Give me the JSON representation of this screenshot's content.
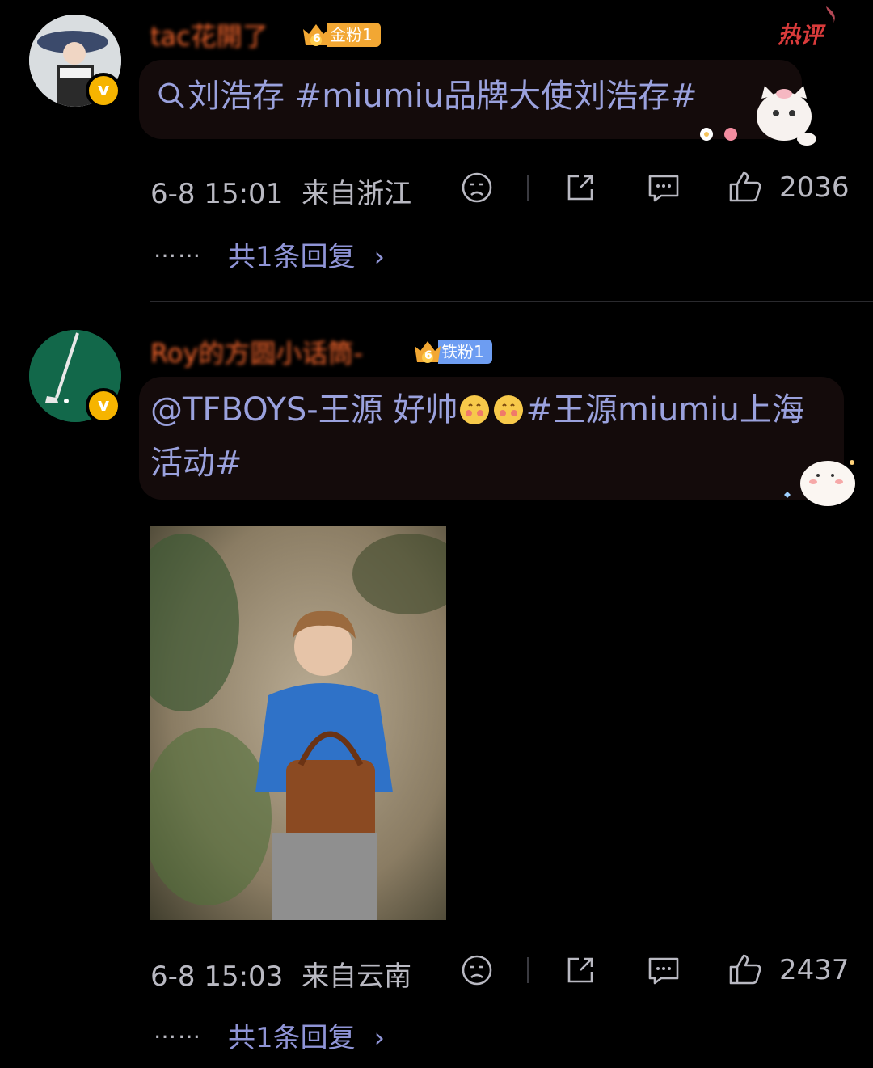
{
  "hot_badge": "热评",
  "comments": [
    {
      "username": "tac花開了",
      "fan_badge": "金粉1",
      "fan_level": "6",
      "text_prefix": "刘浩存 #miumiu品牌大使刘浩存#",
      "search_icon": "search-icon",
      "time": "6-8 15:01",
      "location": "来自浙江",
      "likes": "2036",
      "replies": "共1条回复",
      "colors": {
        "fan_badge": "#f2a733"
      }
    },
    {
      "username": "Roy的方圆小话筒-",
      "fan_badge": "铁粉1",
      "fan_level": "6",
      "text": "@TFBOYS-王源 好帅",
      "text_tail": "#王源miumiu上海活动#",
      "time": "6-8 15:03",
      "location": "来自云南",
      "likes": "2437",
      "replies": "共1条回复",
      "colors": {
        "fan_badge": "#6d9df2"
      }
    }
  ],
  "dots": "……",
  "colors": {
    "accent": "#9aa1dd",
    "username": "#ff6a2e",
    "background": "#000000"
  }
}
